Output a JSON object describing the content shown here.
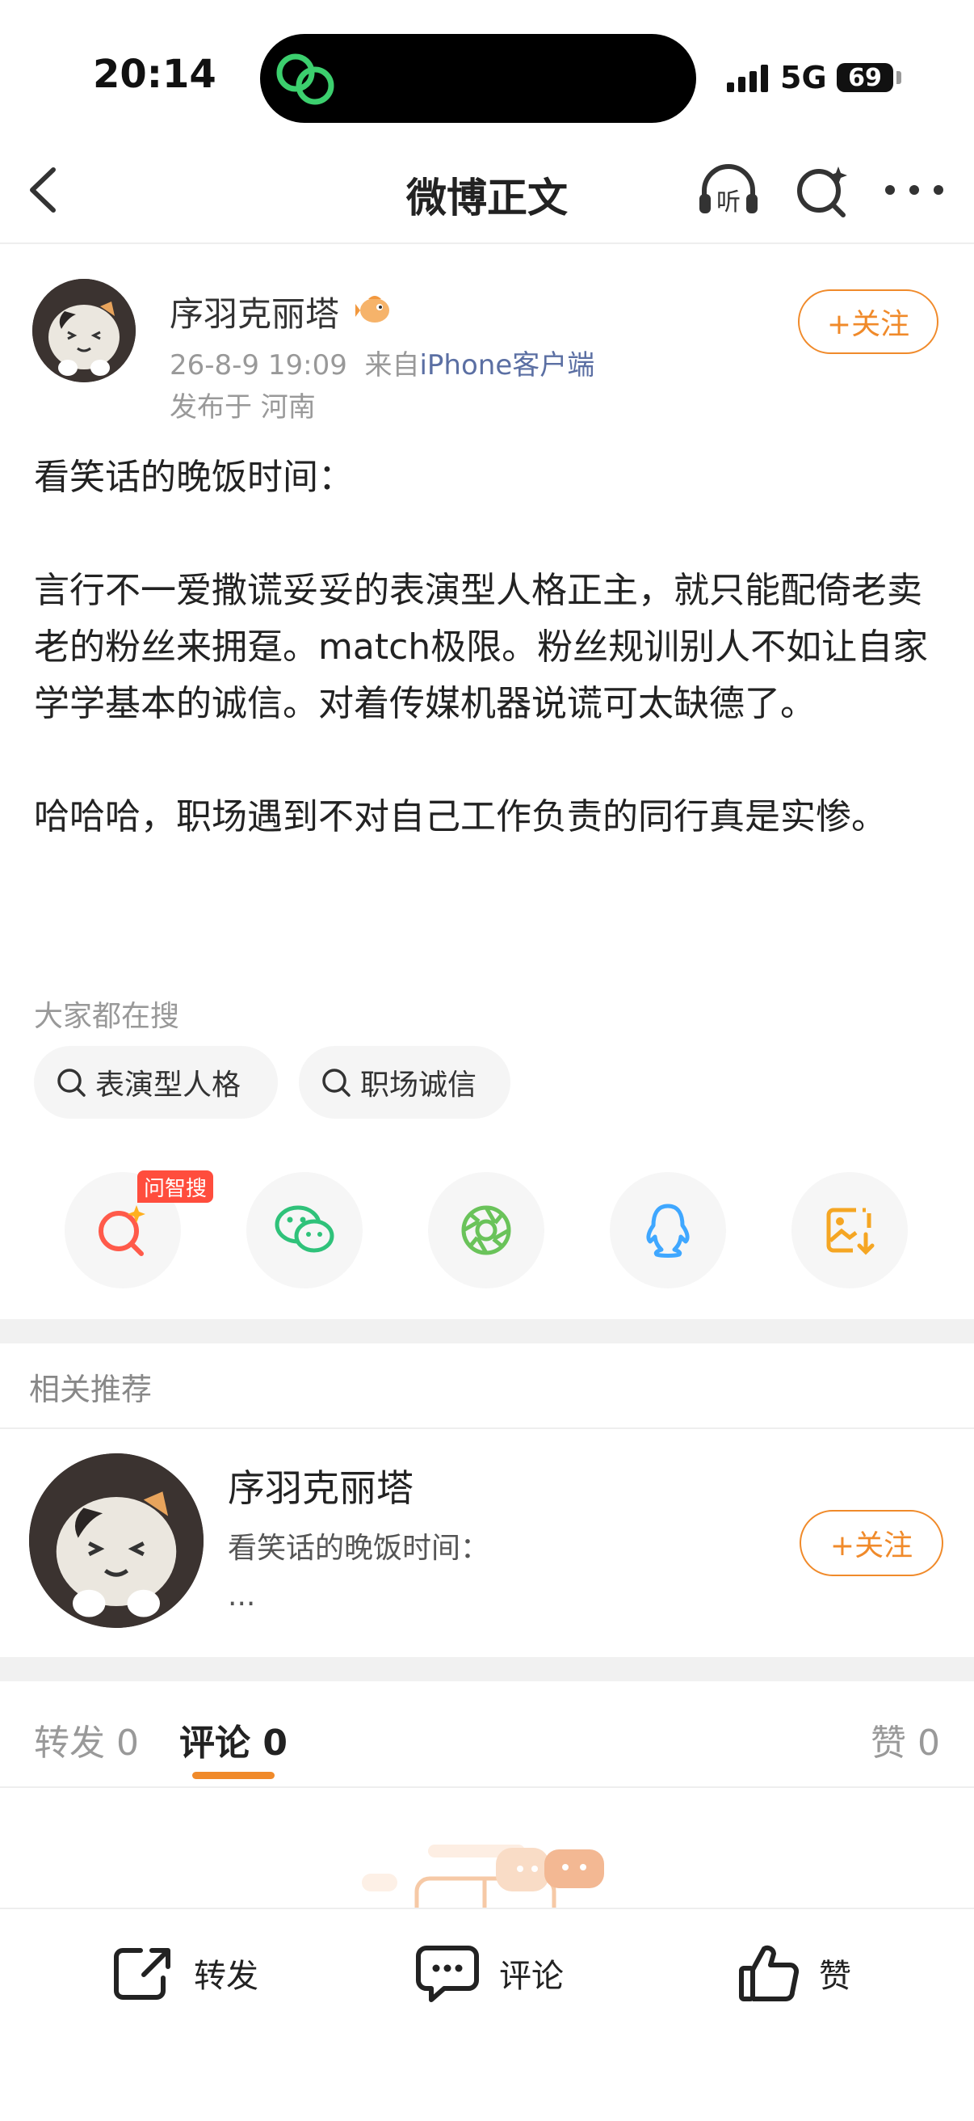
{
  "status": {
    "time": "20:14",
    "network": "5G",
    "battery": "69"
  },
  "nav": {
    "title": "微博正文"
  },
  "post": {
    "author": "序羽克丽塔",
    "time": "26-8-9 19:09",
    "from_prefix": "来自",
    "source": "iPhone客户端",
    "location": "发布于 河南",
    "follow_label": "+关注",
    "paragraphs": [
      "看笑话的晚饭时间：",
      "言行不一爱撒谎妥妥的表演型人格正主，就只能配倚老卖老的粉丝来拥趸。match极限。粉丝规训别人不如让自家学学基本的诚信。对着传媒机器说谎可太缺德了。",
      "哈哈哈，职场遇到不对自己工作负责的同行真是实惨。"
    ]
  },
  "hot_search": {
    "label": "大家都在搜",
    "chips": [
      "表演型人格",
      "职场诚信"
    ]
  },
  "share": {
    "badge": "问智搜"
  },
  "related": {
    "title": "相关推荐",
    "name": "序羽克丽塔",
    "text": "看笑话的晚饭时间：",
    "ellipsis": "...",
    "follow_label": "+关注"
  },
  "tabs": {
    "repost": "转发 0",
    "comment": "评论 0",
    "like": "赞 0"
  },
  "bottom_bar": {
    "repost": "转发",
    "comment": "评论",
    "like": "赞"
  },
  "colors": {
    "accent": "#f08a2a",
    "link": "#5b6fa3",
    "badge": "#ff4d3d"
  }
}
